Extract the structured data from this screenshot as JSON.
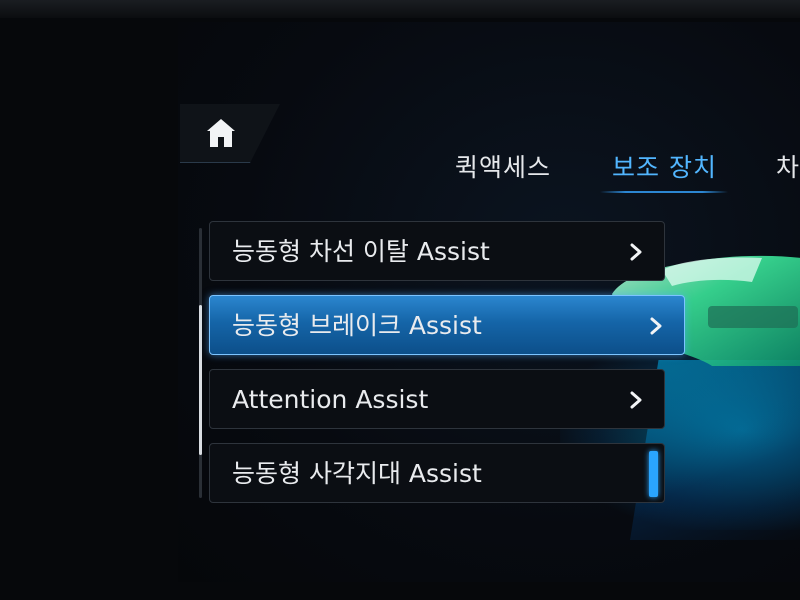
{
  "tabs": [
    {
      "label": "퀵액세스"
    },
    {
      "label": "보조 장치"
    },
    {
      "label": "차"
    }
  ],
  "active_tab": "보조 장치",
  "menu": {
    "items": [
      {
        "label": "능동형 차선 이탈 Assist",
        "control": "chevron"
      },
      {
        "label": "능동형 브레이크 Assist",
        "control": "chevron"
      },
      {
        "label": "Attention Assist",
        "control": "chevron"
      },
      {
        "label": "능동형 사각지대 Assist",
        "control": "toggle"
      }
    ],
    "selected_index": 1
  },
  "icons": {
    "home": "home-icon",
    "chevron": "chevron-right-icon"
  },
  "colors": {
    "accent": "#52b6ff",
    "selected_bg": "#1565a8",
    "toggle_on": "#2aa5ff",
    "car_glow": "#3df0a0"
  }
}
